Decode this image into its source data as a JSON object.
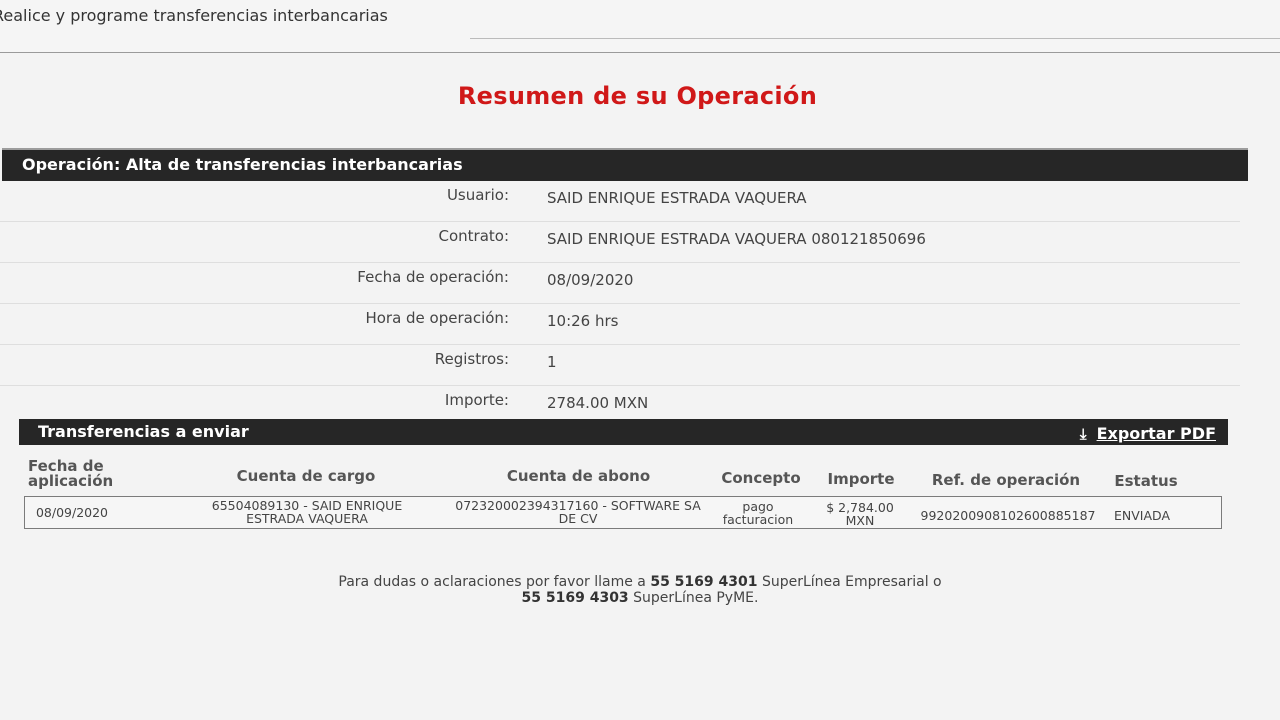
{
  "topbar": {
    "title": "Realice y programe transferencias interbancarias"
  },
  "summary": {
    "title": "Resumen de su Operación"
  },
  "operation": {
    "band_label": "Operación: Alta de transferencias interbancarias",
    "fields": [
      {
        "label": "Usuario:",
        "value": "SAID ENRIQUE ESTRADA VAQUERA"
      },
      {
        "label": "Contrato:",
        "value": "SAID ENRIQUE ESTRADA VAQUERA 080121850696"
      },
      {
        "label": "Fecha de operación:",
        "value": "08/09/2020"
      },
      {
        "label": "Hora de operación:",
        "value": "10:26 hrs"
      },
      {
        "label": "Registros:",
        "value": "1"
      },
      {
        "label": "Importe:",
        "value": "2784.00 MXN"
      }
    ]
  },
  "transfers": {
    "band_label": "Transferencias a enviar",
    "export_label": "Exportar PDF",
    "export_icon": "download-icon",
    "headers": {
      "fecha": "Fecha de aplicación",
      "cargo": "Cuenta de cargo",
      "abono": "Cuenta de abono",
      "concepto": "Concepto",
      "importe": "Importe",
      "ref": "Ref. de operación",
      "estatus": "Estatus"
    },
    "rows": [
      {
        "fecha": "08/09/2020",
        "cargo": "65504089130 - SAID ENRIQUE ESTRADA VAQUERA",
        "abono": "072320002394317160 - SOFTWARE SA DE CV",
        "concepto": "pago facturacion",
        "importe": "$ 2,784.00 MXN",
        "ref": "9920200908102600885187",
        "estatus": "ENVIADA"
      }
    ]
  },
  "footer": {
    "text_1": "Para dudas o aclaraciones por favor llame a",
    "phone_1": "55 5169 4301",
    "text_2": "SuperLínea Empresarial o",
    "phone_2": "55 5169 4303",
    "text_3": "SuperLínea PyME."
  },
  "colors": {
    "title_red": "#d01818",
    "band_dark": "#262626"
  }
}
